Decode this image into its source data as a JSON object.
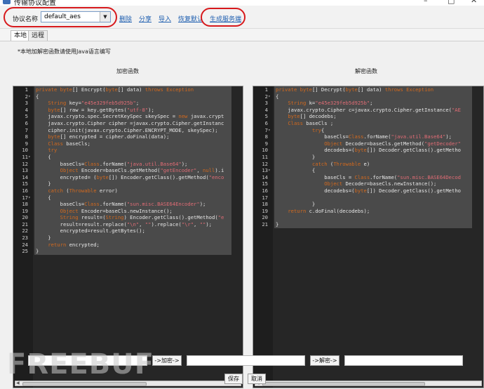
{
  "window": {
    "title": "传输协议配置",
    "min": "–",
    "max": "□",
    "close": "✕"
  },
  "toolbar": {
    "protocol_label": "协议名称",
    "protocol_value": "default_aes",
    "links": [
      "删除",
      "分享",
      "导入",
      "恢复默认",
      "生成服务端"
    ]
  },
  "tabs": [
    {
      "label": "本地",
      "active": true
    },
    {
      "label": "远程",
      "active": false
    }
  ],
  "note": "*本地加解密函数请使用Java语言编写",
  "encrypt": {
    "title": "加密函数",
    "lines": [
      "private byte[] Encrypt(byte[] data) throws Exception",
      "{",
      "    String key=\"e45e329feb5d925b\";",
      "    byte[] raw = key.getBytes(\"utf-8\");",
      "    javax.crypto.spec.SecretKeySpec skeySpec = new javax.crypt",
      "    javax.crypto.Cipher cipher =javax.crypto.Cipher.getInstanc",
      "    cipher.init(javax.crypto.Cipher.ENCRYPT_MODE, skeySpec);",
      "    byte[] encrypted = cipher.doFinal(data);",
      "    Class baseCls;",
      "    try",
      "    {",
      "        baseCls=Class.forName(\"java.util.Base64\");",
      "        Object Encoder=baseCls.getMethod(\"getEncoder\", null).i",
      "        encrypted= (byte[]) Encoder.getClass().getMethod(\"enco",
      "    }",
      "    catch (Throwable error)",
      "    {",
      "        baseCls=Class.forName(\"sun.misc.BASE64Encoder\");",
      "        Object Encoder=baseCls.newInstance();",
      "        String result=(String) Encoder.getClass().getMethod(\"e",
      "        result=result.replace(\"\\n\", \"\").replace(\"\\r\", \"\");",
      "        encrypted=result.getBytes();",
      "    }",
      "    return encrypted;",
      "}"
    ],
    "fold_lines": [
      2,
      11,
      17
    ]
  },
  "decrypt": {
    "title": "解密函数",
    "lines": [
      "private byte[] Decrypt(byte[] data) throws Exception",
      "{",
      "    String k=\"e45e329feb5d925b\";",
      "    javax.crypto.Cipher c=javax.crypto.Cipher.getInstance(\"AE",
      "    byte[] decodebs;",
      "    Class baseCls ;",
      "            try{",
      "                baseCls=Class.forName(\"java.util.Base64\");",
      "                Object Decoder=baseCls.getMethod(\"getDecoder\"",
      "                decodebs=(byte[]) Decoder.getClass().getMetho",
      "            }",
      "            catch (Throwable e)",
      "            {",
      "                baseCls = Class.forName(\"sun.misc.BASE64Decod",
      "                Object Decoder=baseCls.newInstance();",
      "                decodebs=(byte[]) Decoder.getClass().getMetho",
      "",
      "            }",
      "    return c.doFinal(decodebs);",
      "",
      "}"
    ],
    "fold_lines": [
      2,
      7,
      13
    ]
  },
  "bottom": {
    "encrypt_btn": "->加密->",
    "decrypt_btn": "->解密->",
    "save_btn": "保存",
    "cancel_btn": "取消"
  },
  "watermark": "FREEBUF",
  "colors": {
    "keyword": "#d2691e",
    "string": "#e06c75",
    "annotation_oval": "#d7191c",
    "link": "#1f5fb0"
  }
}
